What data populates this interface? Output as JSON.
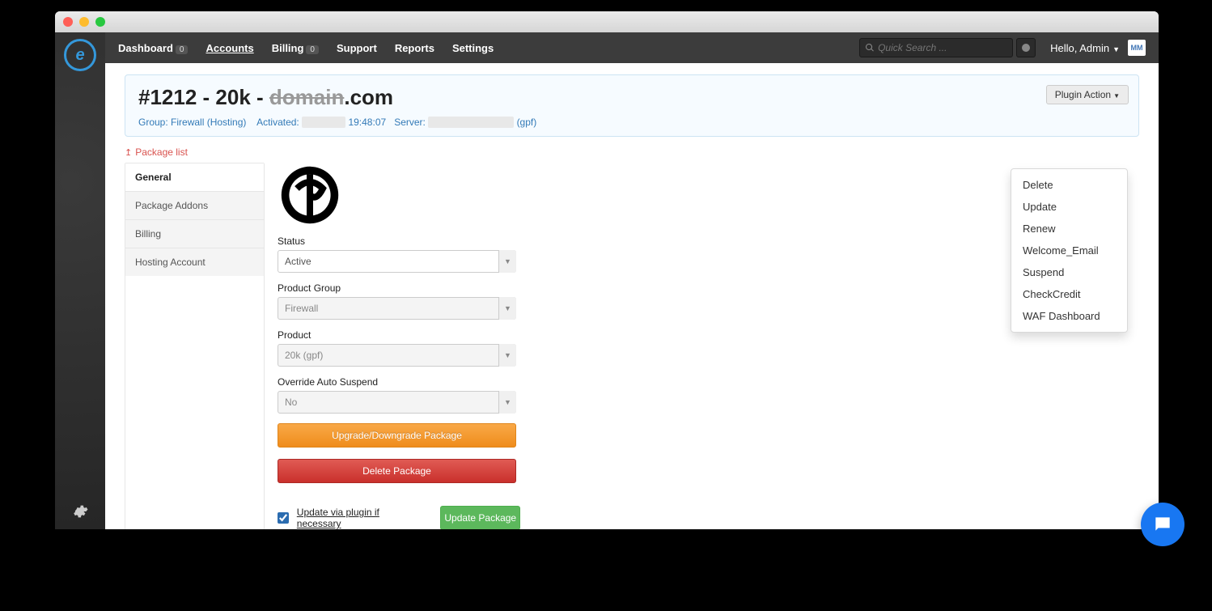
{
  "topnav": {
    "items": [
      {
        "label": "Dashboard",
        "badge": "0"
      },
      {
        "label": "Accounts",
        "active": true
      },
      {
        "label": "Billing",
        "badge": "0"
      },
      {
        "label": "Support"
      },
      {
        "label": "Reports"
      },
      {
        "label": "Settings"
      }
    ],
    "search_placeholder": "Quick Search ...",
    "user_greeting": "Hello, Admin",
    "mm": "MM"
  },
  "header": {
    "title_prefix": "#1212 - 20k - ",
    "title_domain": "domain",
    "title_suffix": ".com",
    "group_label": "Group:",
    "group_value": "Firewall (Hosting)",
    "activated_label": "Activated:",
    "activated_time": "19:48:07",
    "server_label": "Server:",
    "server_suffix": "(gpf)",
    "plugin_action": "Plugin Action"
  },
  "dropdown": [
    "Delete",
    "Update",
    "Renew",
    "Welcome_Email",
    "Suspend",
    "CheckCredit",
    "WAF Dashboard"
  ],
  "backlink": "Package list",
  "side_tabs": [
    "General",
    "Package Addons",
    "Billing",
    "Hosting Account"
  ],
  "form": {
    "status": {
      "label": "Status",
      "value": "Active"
    },
    "group": {
      "label": "Product Group",
      "value": "Firewall"
    },
    "product": {
      "label": "Product",
      "value": "20k (gpf)"
    },
    "suspend": {
      "label": "Override Auto Suspend",
      "value": "No"
    },
    "upgrade_btn": "Upgrade/Downgrade Package",
    "delete_btn": "Delete Package",
    "checkbox_label": "Update via plugin if necessary",
    "update_btn": "Update Package"
  }
}
